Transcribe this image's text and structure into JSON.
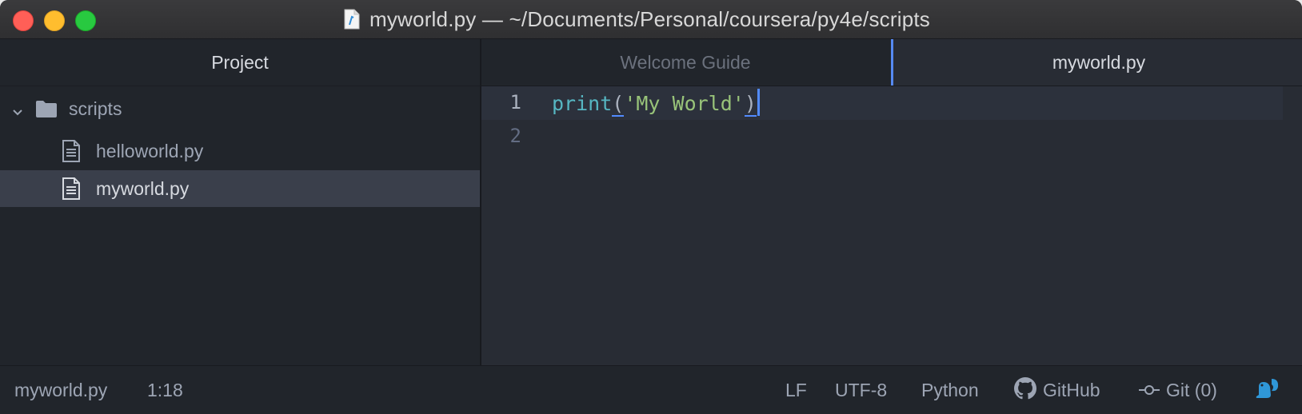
{
  "window": {
    "title": "myworld.py — ~/Documents/Personal/coursera/py4e/scripts"
  },
  "sidebar": {
    "header": "Project",
    "folder": {
      "name": "scripts",
      "expanded": true
    },
    "files": [
      {
        "name": "helloworld.py",
        "selected": false
      },
      {
        "name": "myworld.py",
        "selected": true
      }
    ]
  },
  "tabs": [
    {
      "label": "Welcome Guide",
      "active": false
    },
    {
      "label": "myworld.py",
      "active": true
    }
  ],
  "editor": {
    "line_numbers": [
      "1",
      "2"
    ],
    "code": {
      "fn": "print",
      "open": "(",
      "string": "'My World'",
      "close": ")"
    }
  },
  "status_bar": {
    "file": "myworld.py",
    "cursor": "1:18",
    "line_ending": "LF",
    "encoding": "UTF-8",
    "grammar": "Python",
    "github": "GitHub",
    "git": "Git (0)"
  },
  "colors": {
    "accent": "#568af2",
    "function": "#56b6c2",
    "string": "#98c379"
  },
  "icons": [
    "document-icon",
    "chevron-down-icon",
    "folder-icon",
    "file-icon",
    "github-icon",
    "git-commit-icon",
    "squirrel-icon"
  ]
}
